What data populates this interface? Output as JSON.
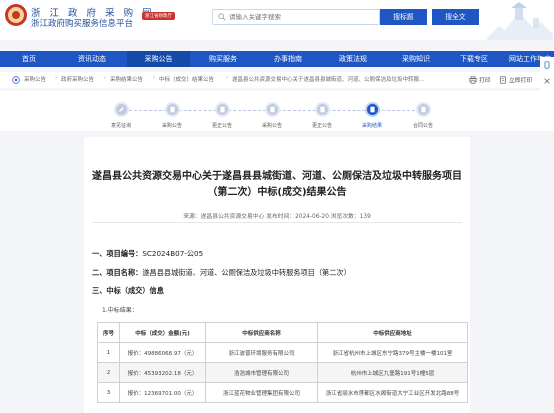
{
  "header": {
    "title_line1": "浙 江 政 府 采 购 网",
    "title_line2": "浙江政府购买服务信息平台",
    "badge": "浙江省财政厅",
    "search_placeholder": "请输入关键字搜索",
    "btn_site": "搜标题",
    "btn_all": "搜全文"
  },
  "nav": [
    {
      "label": "首页",
      "active": false
    },
    {
      "label": "资讯动态",
      "active": false
    },
    {
      "label": "采购公告",
      "active": true
    },
    {
      "label": "购买服务",
      "active": false
    },
    {
      "label": "办事指南",
      "active": false
    },
    {
      "label": "政策法规",
      "active": false
    },
    {
      "label": "采购知识",
      "active": false
    },
    {
      "label": "下载专区",
      "active": false
    },
    {
      "label": "网站工作年度",
      "active": false
    }
  ],
  "breadcrumb": {
    "items": [
      "采购公告",
      "政府采购公告",
      "采购结果公告",
      "中标（成交）结果公告",
      "遂昌县公共资源交易中心关于遂昌县县城街道、河道、公厕保洁及垃圾中转服..."
    ],
    "print": "打印",
    "original": "立即打印"
  },
  "steps": [
    {
      "label": "意见征询",
      "active": false
    },
    {
      "label": "采购公告",
      "active": false
    },
    {
      "label": "更正公告",
      "active": false
    },
    {
      "label": "采购公告",
      "active": false
    },
    {
      "label": "更正公告",
      "active": false
    },
    {
      "label": "采购结果",
      "active": true
    },
    {
      "label": "合同公告",
      "active": false
    }
  ],
  "article": {
    "title": "遂昌县公共资源交易中心关于遂昌县县城街道、河道、公厕保洁及垃圾中转服务项目（第二次）中标(成交)结果公告",
    "meta": "来源：遂昌县公共资源交易中心    发布时间：2024-06-20    浏览次数：139",
    "sec1": "一、项目编号：",
    "sec1_val": "SC2024B07-公05",
    "sec2": "二、项目名称：",
    "sec2_val": "遂昌县县城街道、河道、公厕保洁及垃圾中转服务项目（第二次）",
    "sec3": "三、中标（成交）信息",
    "sub1": "1.中标结果："
  },
  "table": {
    "headers": [
      "序号",
      "中标（成交）金额(元)",
      "中标供应商名称",
      "中标供应商地址"
    ],
    "rows": [
      [
        "1",
        "报价：49886068.97（元）",
        "浙江波普环境服务有限公司",
        "浙江省杭州市上城区东宁路379号主楼一楼101室"
      ],
      [
        "2",
        "报价：45393202.18（元）",
        "浩浩城市管理有限公司",
        "杭州市上城区九堡路191号1幢5层"
      ],
      [
        "3",
        "报价：12369701.00（元）",
        "浙江蓝花物业管理集团有限公司",
        "浙江省丽水市莲都区水阁街道大宁工业区开发北路88号"
      ]
    ]
  }
}
